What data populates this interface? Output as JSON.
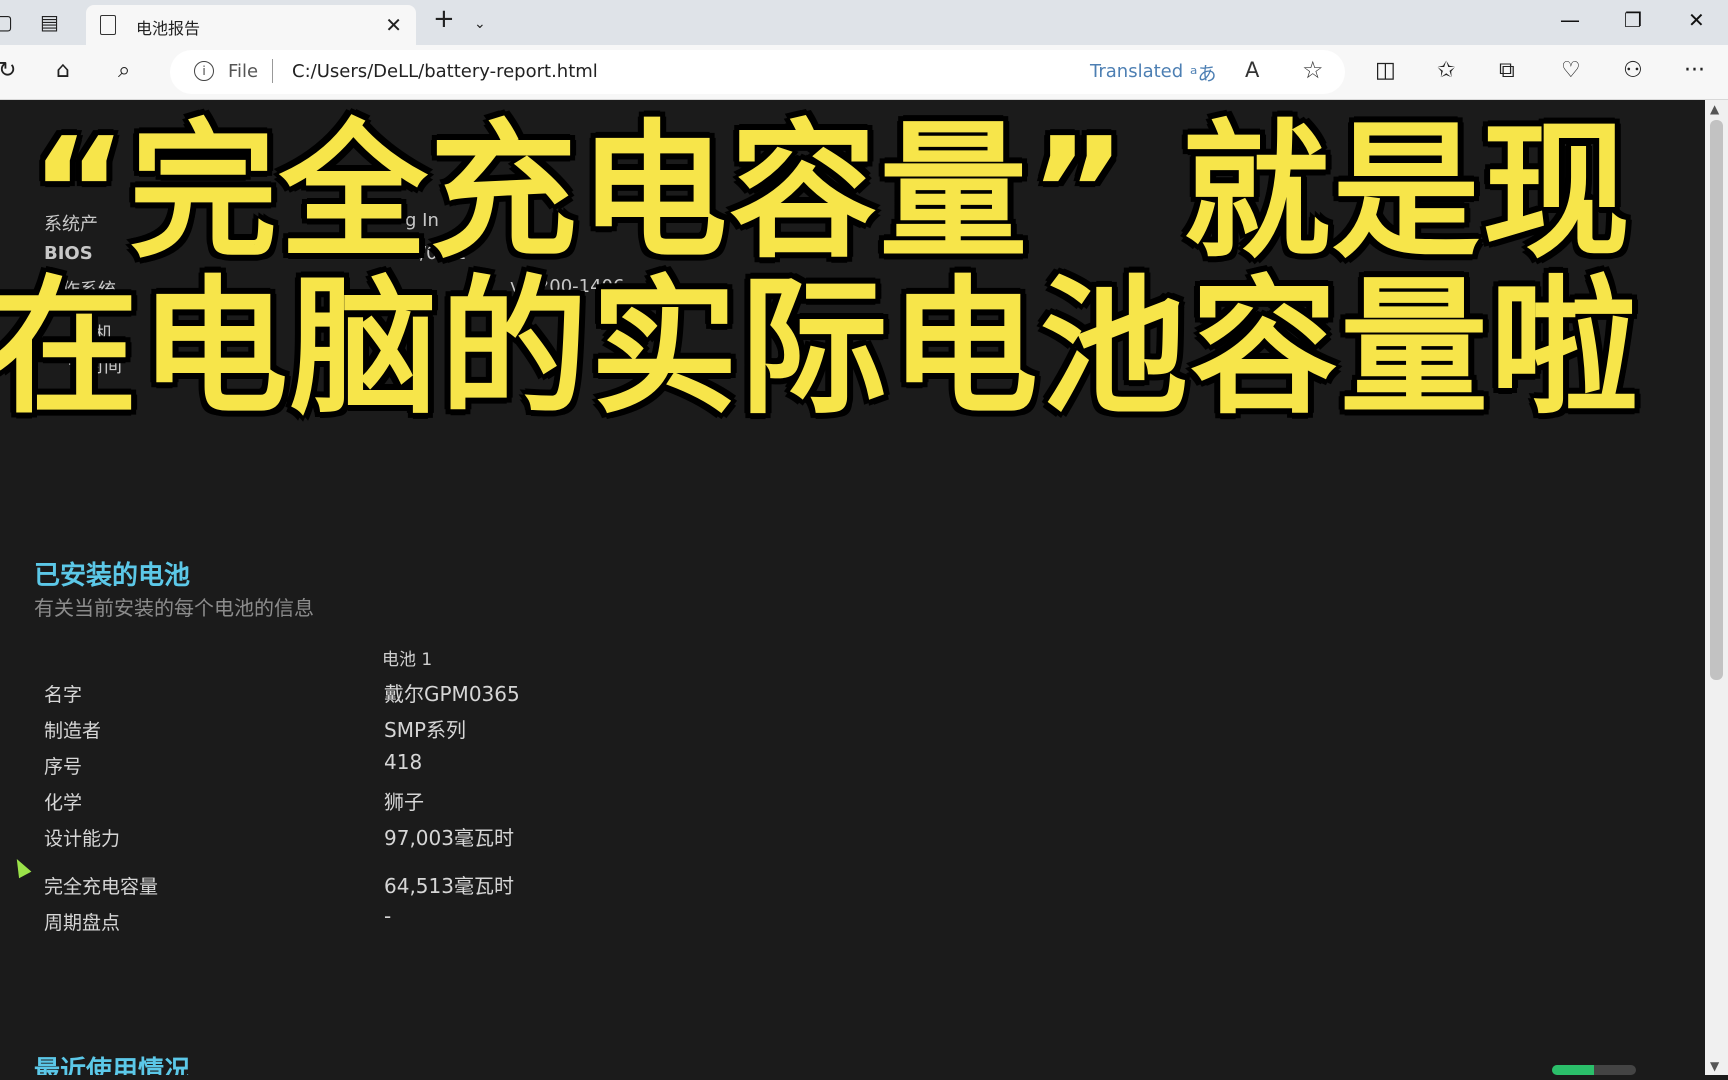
{
  "browser": {
    "tab_title": "电池报告",
    "address_scheme": "File",
    "address_url": "C:/Users/DeLL/battery-report.html",
    "translated_label": "Translated",
    "translate_icon_glyph": "ᵃあ",
    "read_aloud_glyph": "A",
    "new_tab_glyph": "+",
    "close_tab_glyph": "✕",
    "minimize_glyph": "—",
    "restore_glyph": "❐",
    "close_window_glyph": "✕",
    "more_glyph": "···"
  },
  "background_fragments": {
    "system_product": "系统产",
    "system_product_value": "g In",
    "bios": "BIOS",
    "bios_value": "/01/2",
    "os": "操作系统",
    "os_value": "vb 200-1406",
    "machine": "机",
    "time": "告时间",
    "time_value": "1"
  },
  "installed": {
    "title": "已安装的电池",
    "subtitle": "有关当前安装的每个电池的信息",
    "column_header": "电池 1",
    "rows": [
      {
        "label": "名字",
        "value": "戴尔GPM0365"
      },
      {
        "label": "制造者",
        "value": "SMP系列"
      },
      {
        "label": "序号",
        "value": "418"
      },
      {
        "label": "化学",
        "value": "狮子"
      },
      {
        "label": "设计能力",
        "value": "97,003毫瓦时"
      },
      {
        "label": "完全充电容量",
        "value": "64,513毫瓦时"
      },
      {
        "label": "周期盘点",
        "value": "-"
      }
    ]
  },
  "next_section_title": "最近使用情况",
  "caption": {
    "line1": "“完全充电容量” 就是现",
    "line2": "在电脑的实际电池容量啦"
  },
  "colors": {
    "caption_fill": "#f7e54a",
    "section_title": "#5cc8e8",
    "page_background": "#1b1b1b"
  }
}
